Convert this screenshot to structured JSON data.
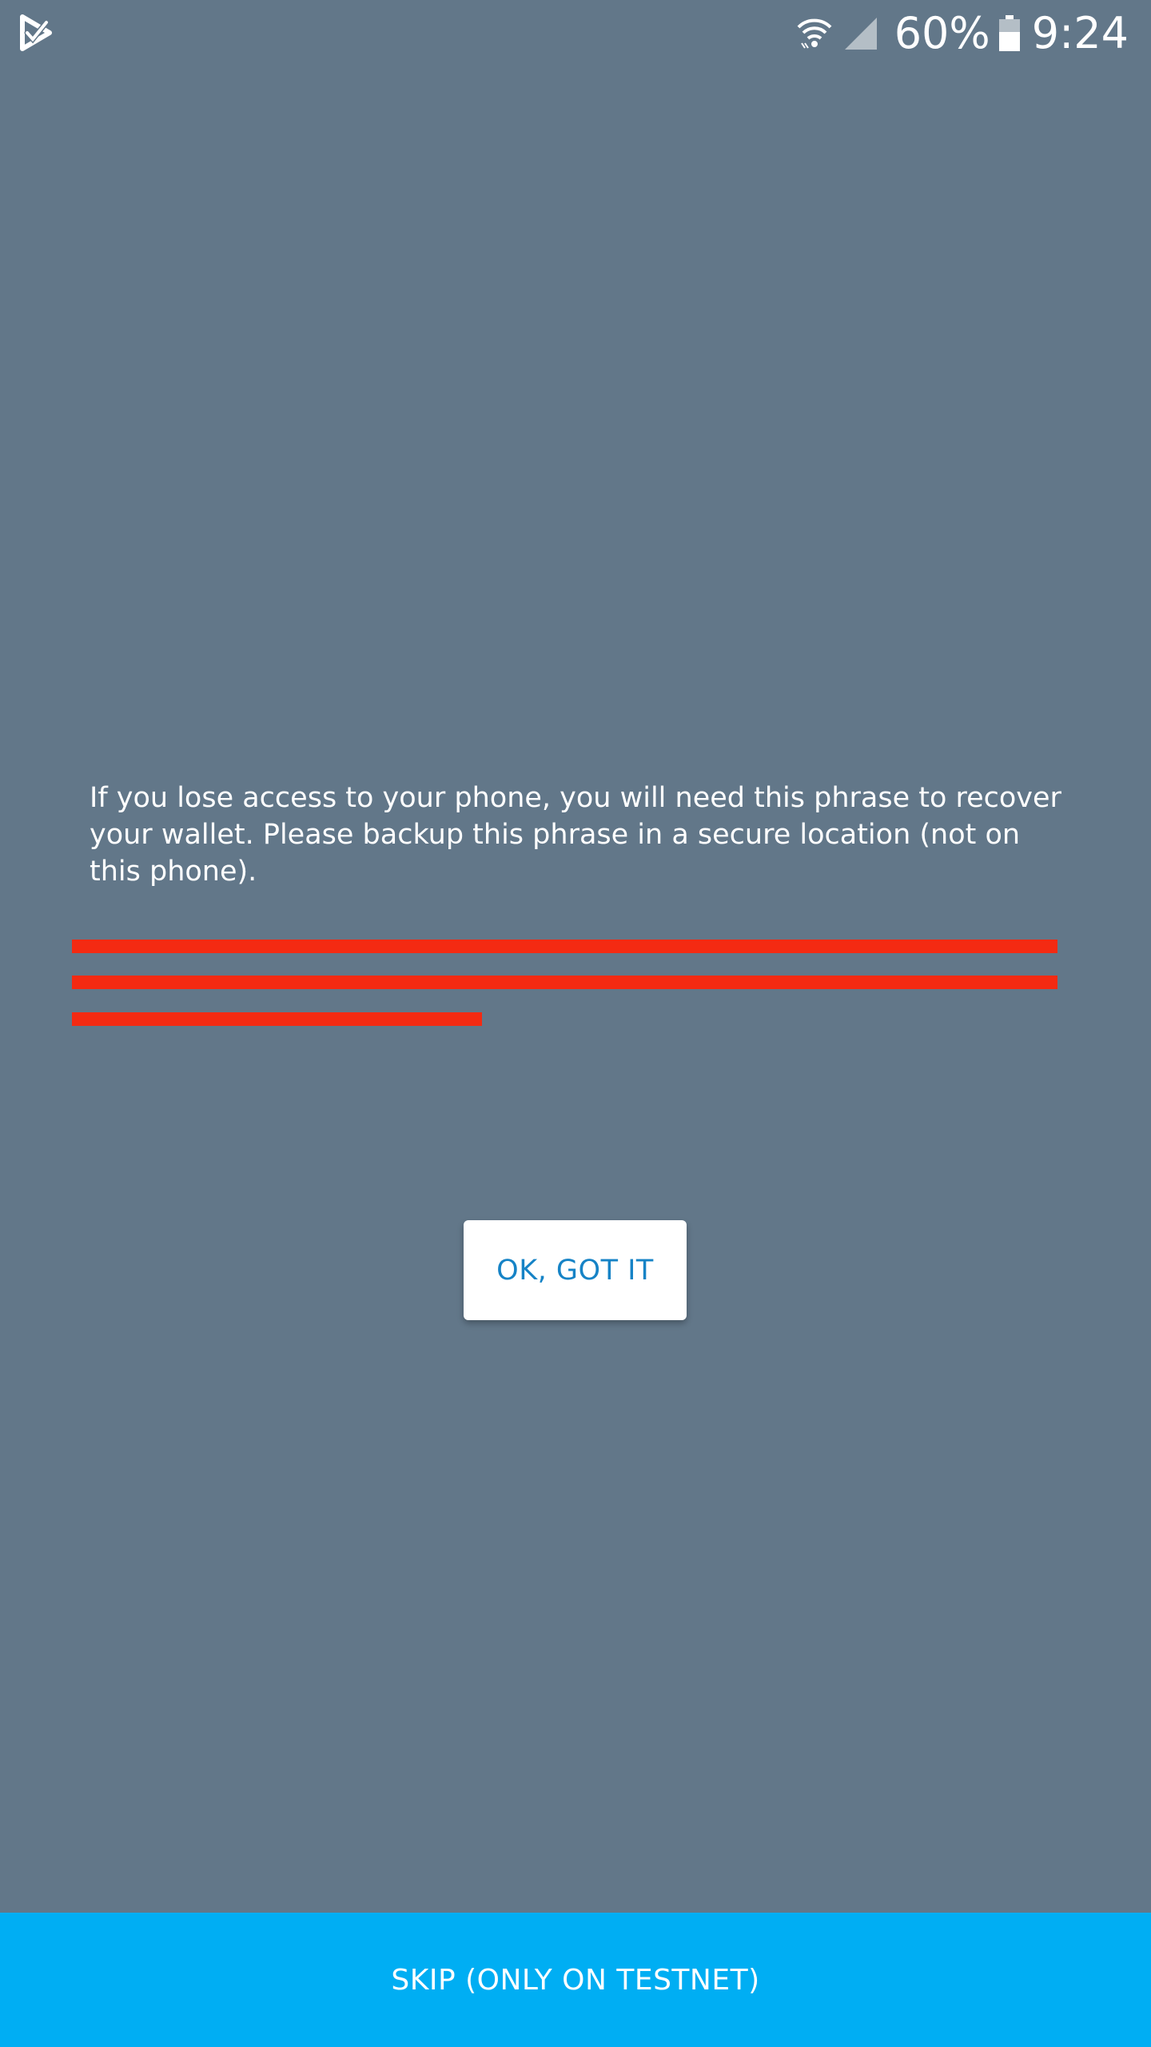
{
  "status_bar": {
    "app_icon": "app-notification-icon",
    "wifi_icon": "wifi-icon",
    "signal_icon": "cell-signal-icon",
    "battery_percent": "60%",
    "battery_icon": "battery-icon",
    "time": "9:24"
  },
  "main": {
    "info_text": "If you lose access to your phone, you will need this phrase to recover your wallet. Please backup this phrase in a secure location (not on this phone).",
    "ok_button_label": "OK, GOT IT"
  },
  "footer": {
    "skip_label": "SKIP (ONLY ON TESTNET)"
  },
  "colors": {
    "background": "#627789",
    "redaction": "#f42a12",
    "button_text": "#1683c6",
    "footer_bg": "#00aef3"
  }
}
